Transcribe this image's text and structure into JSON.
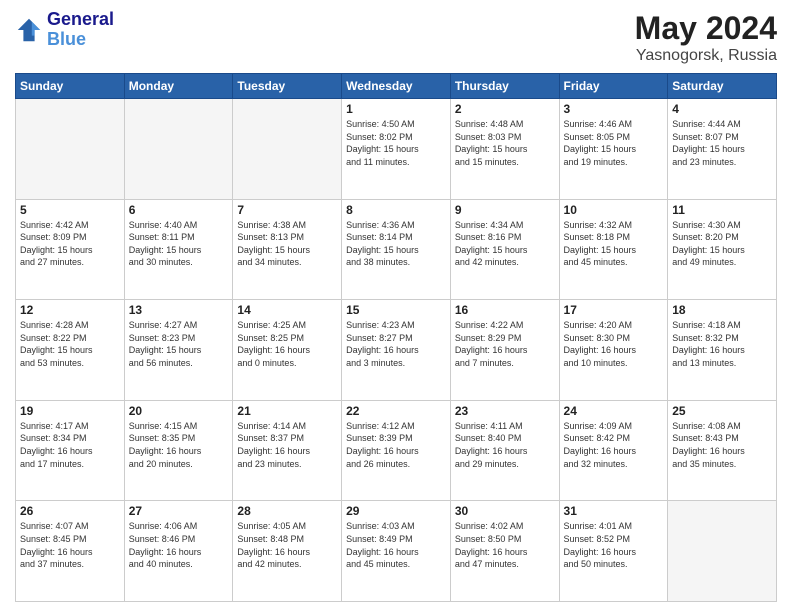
{
  "header": {
    "logo_line1": "General",
    "logo_line2": "Blue",
    "title": "May 2024",
    "subtitle": "Yasnogorsk, Russia"
  },
  "columns": [
    "Sunday",
    "Monday",
    "Tuesday",
    "Wednesday",
    "Thursday",
    "Friday",
    "Saturday"
  ],
  "weeks": [
    [
      {
        "day": "",
        "info": ""
      },
      {
        "day": "",
        "info": ""
      },
      {
        "day": "",
        "info": ""
      },
      {
        "day": "1",
        "info": "Sunrise: 4:50 AM\nSunset: 8:02 PM\nDaylight: 15 hours\nand 11 minutes."
      },
      {
        "day": "2",
        "info": "Sunrise: 4:48 AM\nSunset: 8:03 PM\nDaylight: 15 hours\nand 15 minutes."
      },
      {
        "day": "3",
        "info": "Sunrise: 4:46 AM\nSunset: 8:05 PM\nDaylight: 15 hours\nand 19 minutes."
      },
      {
        "day": "4",
        "info": "Sunrise: 4:44 AM\nSunset: 8:07 PM\nDaylight: 15 hours\nand 23 minutes."
      }
    ],
    [
      {
        "day": "5",
        "info": "Sunrise: 4:42 AM\nSunset: 8:09 PM\nDaylight: 15 hours\nand 27 minutes."
      },
      {
        "day": "6",
        "info": "Sunrise: 4:40 AM\nSunset: 8:11 PM\nDaylight: 15 hours\nand 30 minutes."
      },
      {
        "day": "7",
        "info": "Sunrise: 4:38 AM\nSunset: 8:13 PM\nDaylight: 15 hours\nand 34 minutes."
      },
      {
        "day": "8",
        "info": "Sunrise: 4:36 AM\nSunset: 8:14 PM\nDaylight: 15 hours\nand 38 minutes."
      },
      {
        "day": "9",
        "info": "Sunrise: 4:34 AM\nSunset: 8:16 PM\nDaylight: 15 hours\nand 42 minutes."
      },
      {
        "day": "10",
        "info": "Sunrise: 4:32 AM\nSunset: 8:18 PM\nDaylight: 15 hours\nand 45 minutes."
      },
      {
        "day": "11",
        "info": "Sunrise: 4:30 AM\nSunset: 8:20 PM\nDaylight: 15 hours\nand 49 minutes."
      }
    ],
    [
      {
        "day": "12",
        "info": "Sunrise: 4:28 AM\nSunset: 8:22 PM\nDaylight: 15 hours\nand 53 minutes."
      },
      {
        "day": "13",
        "info": "Sunrise: 4:27 AM\nSunset: 8:23 PM\nDaylight: 15 hours\nand 56 minutes."
      },
      {
        "day": "14",
        "info": "Sunrise: 4:25 AM\nSunset: 8:25 PM\nDaylight: 16 hours\nand 0 minutes."
      },
      {
        "day": "15",
        "info": "Sunrise: 4:23 AM\nSunset: 8:27 PM\nDaylight: 16 hours\nand 3 minutes."
      },
      {
        "day": "16",
        "info": "Sunrise: 4:22 AM\nSunset: 8:29 PM\nDaylight: 16 hours\nand 7 minutes."
      },
      {
        "day": "17",
        "info": "Sunrise: 4:20 AM\nSunset: 8:30 PM\nDaylight: 16 hours\nand 10 minutes."
      },
      {
        "day": "18",
        "info": "Sunrise: 4:18 AM\nSunset: 8:32 PM\nDaylight: 16 hours\nand 13 minutes."
      }
    ],
    [
      {
        "day": "19",
        "info": "Sunrise: 4:17 AM\nSunset: 8:34 PM\nDaylight: 16 hours\nand 17 minutes."
      },
      {
        "day": "20",
        "info": "Sunrise: 4:15 AM\nSunset: 8:35 PM\nDaylight: 16 hours\nand 20 minutes."
      },
      {
        "day": "21",
        "info": "Sunrise: 4:14 AM\nSunset: 8:37 PM\nDaylight: 16 hours\nand 23 minutes."
      },
      {
        "day": "22",
        "info": "Sunrise: 4:12 AM\nSunset: 8:39 PM\nDaylight: 16 hours\nand 26 minutes."
      },
      {
        "day": "23",
        "info": "Sunrise: 4:11 AM\nSunset: 8:40 PM\nDaylight: 16 hours\nand 29 minutes."
      },
      {
        "day": "24",
        "info": "Sunrise: 4:09 AM\nSunset: 8:42 PM\nDaylight: 16 hours\nand 32 minutes."
      },
      {
        "day": "25",
        "info": "Sunrise: 4:08 AM\nSunset: 8:43 PM\nDaylight: 16 hours\nand 35 minutes."
      }
    ],
    [
      {
        "day": "26",
        "info": "Sunrise: 4:07 AM\nSunset: 8:45 PM\nDaylight: 16 hours\nand 37 minutes."
      },
      {
        "day": "27",
        "info": "Sunrise: 4:06 AM\nSunset: 8:46 PM\nDaylight: 16 hours\nand 40 minutes."
      },
      {
        "day": "28",
        "info": "Sunrise: 4:05 AM\nSunset: 8:48 PM\nDaylight: 16 hours\nand 42 minutes."
      },
      {
        "day": "29",
        "info": "Sunrise: 4:03 AM\nSunset: 8:49 PM\nDaylight: 16 hours\nand 45 minutes."
      },
      {
        "day": "30",
        "info": "Sunrise: 4:02 AM\nSunset: 8:50 PM\nDaylight: 16 hours\nand 47 minutes."
      },
      {
        "day": "31",
        "info": "Sunrise: 4:01 AM\nSunset: 8:52 PM\nDaylight: 16 hours\nand 50 minutes."
      },
      {
        "day": "",
        "info": ""
      }
    ]
  ]
}
